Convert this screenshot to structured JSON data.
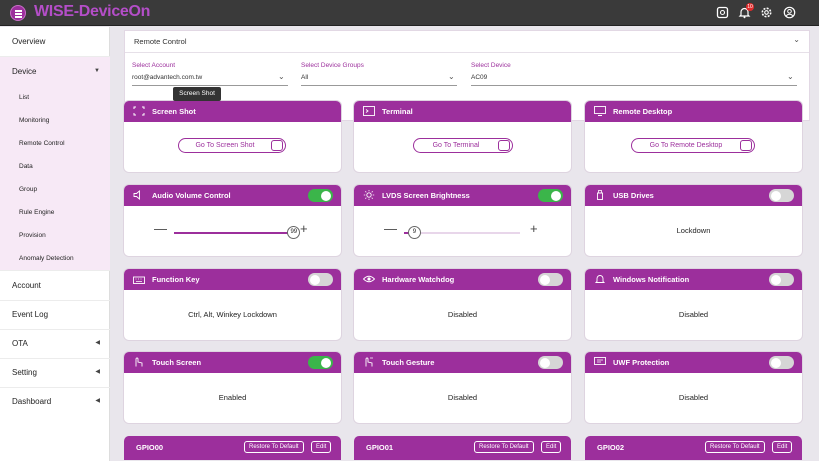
{
  "app": {
    "logo": "WISE-DeviceOn",
    "notification_count": "10"
  },
  "icons": {
    "menu": "menu-icon",
    "tablet": "tablet-icon",
    "bell": "bell-icon",
    "gear": "gear-icon",
    "user": "user-icon"
  },
  "colors": {
    "brand": "#9c2f9c",
    "toggle_on": "#3bb54a",
    "toggle_off": "#d6d6d6",
    "topbar": "#3a3a3a",
    "badge": "#e02b2b"
  },
  "sidebar": {
    "overview": "Overview",
    "device": "Device",
    "device_sub": [
      "List",
      "Monitoring",
      "Remote Control",
      "Data",
      "Group",
      "Rule Engine",
      "Provision",
      "Anomaly Detection"
    ],
    "account": "Account",
    "event_log": "Event Log",
    "ota": "OTA",
    "setting": "Setting",
    "dashboard": "Dashboard"
  },
  "remote_control": {
    "title": "Remote Control",
    "account": {
      "label": "Select Account",
      "value": "root@advantech.com.tw"
    },
    "groups": {
      "label": "Select Device Groups",
      "value": "All"
    },
    "device": {
      "label": "Select Device",
      "value": "AC09"
    }
  },
  "tooltip": "Screen Shot",
  "cards": {
    "screenshot": {
      "title": "Screen Shot",
      "button": "Go To Screen Shot"
    },
    "terminal": {
      "title": "Terminal",
      "button": "Go To Terminal"
    },
    "remote_desktop": {
      "title": "Remote Desktop",
      "button": "Go To Remote Desktop"
    },
    "audio": {
      "title": "Audio Volume Control",
      "on": true,
      "value": "99",
      "level": 99,
      "minus": "—",
      "plus": "+"
    },
    "lvds": {
      "title": "LVDS Screen Brightness",
      "on": true,
      "value": "9",
      "level": 9,
      "minus": "—",
      "plus": "+"
    },
    "usb": {
      "title": "USB Drives",
      "on": false,
      "status": "Lockdown"
    },
    "function_key": {
      "title": "Function Key",
      "on": false,
      "status": "Ctrl, Alt, Winkey Lockdown"
    },
    "watchdog": {
      "title": "Hardware Watchdog",
      "on": false,
      "status": "Disabled"
    },
    "win_notify": {
      "title": "Windows Notification",
      "on": false,
      "status": "Disabled"
    },
    "touch_screen": {
      "title": "Touch Screen",
      "on": true,
      "status": "Enabled"
    },
    "touch_gesture": {
      "title": "Touch Gesture",
      "on": false,
      "status": "Disabled"
    },
    "uwf": {
      "title": "UWF Protection",
      "on": false,
      "status": "Disabled"
    }
  },
  "gpio": [
    {
      "title": "GPIO00",
      "restore": "Restore To Default",
      "edit": "Edit"
    },
    {
      "title": "GPIO01",
      "restore": "Restore To Default",
      "edit": "Edit"
    },
    {
      "title": "GPIO02",
      "restore": "Restore To Default",
      "edit": "Edit"
    }
  ]
}
